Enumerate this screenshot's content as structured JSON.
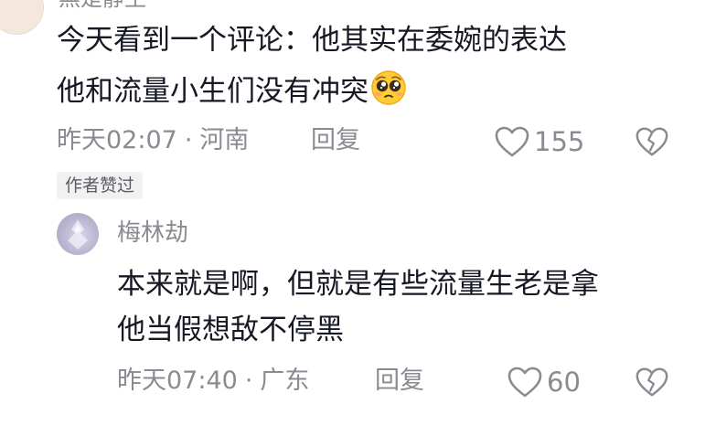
{
  "top_comment": {
    "username": "無是静生",
    "text_lines": [
      "今天看到一个评论：他其实在委婉的表达",
      "他和流量小生们没有冲突"
    ],
    "emoji": "pleading-face-emoji",
    "time": "昨天02:07",
    "separator": "·",
    "location": "河南",
    "reply_label": "回复",
    "like_count": "155",
    "author_badge": "作者赞过"
  },
  "reply_comment": {
    "username": "梅林劫",
    "text_lines": [
      "本来就是啊，但就是有些流量生老是拿",
      "他当假想敌不停黑"
    ],
    "time": "昨天07:40",
    "separator": "·",
    "location": "广东",
    "reply_label": "回复",
    "like_count": "60"
  },
  "icons": {
    "like": "heart-outline-icon",
    "dislike": "broken-heart-icon"
  },
  "colors": {
    "text_primary": "#161823",
    "text_secondary": "#8a8b91",
    "badge_bg": "#f1f1f2"
  }
}
